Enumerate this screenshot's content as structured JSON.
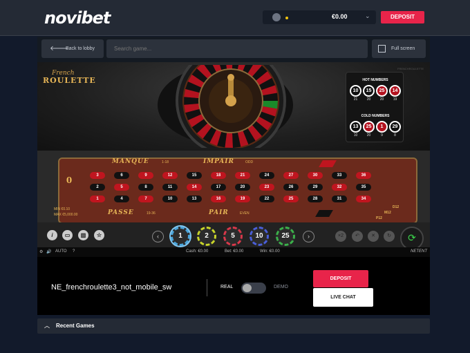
{
  "header": {
    "logo": "novibet",
    "balance": "€0.00",
    "deposit_label": "DEPOSIT"
  },
  "toolbar": {
    "back_label": "Back to lobby",
    "search_placeholder": "Search game...",
    "fullscreen_label": "Full screen"
  },
  "game": {
    "logo_line1": "French",
    "logo_line2": "ROULETTE",
    "watermark": "FRENCHROULETTE",
    "hot_title": "HOT NUMBERS",
    "cold_title": "COLD NUMBERS",
    "hot_numbers": [
      {
        "num": "10",
        "count": "21",
        "color": "black"
      },
      {
        "num": "15",
        "count": "20",
        "color": "black"
      },
      {
        "num": "25",
        "count": "20",
        "color": "red"
      },
      {
        "num": "14",
        "count": "19",
        "color": "red"
      }
    ],
    "cold_numbers": [
      {
        "num": "13",
        "count": "10",
        "color": "black"
      },
      {
        "num": "25",
        "count": "20",
        "color": "red"
      },
      {
        "num": "1",
        "count": "9",
        "color": "red"
      },
      {
        "num": "29",
        "count": "8",
        "color": "black"
      }
    ],
    "table": {
      "zero": "0",
      "manque": "MANQUE",
      "manque_sub": "1-18",
      "impair": "IMPAIR",
      "impair_sub": "ODD",
      "passe": "PASSE",
      "passe_sub": "19-36",
      "pair": "PAIR",
      "pair_sub": "EVEN",
      "min": "MIN €0.10",
      "max": "MAX €5,000.00",
      "d12": "D12",
      "m12": "M12",
      "p12": "P12",
      "rows": [
        [
          {
            "n": "3",
            "c": "red"
          },
          {
            "n": "6",
            "c": "black"
          },
          {
            "n": "9",
            "c": "red"
          },
          {
            "n": "12",
            "c": "red"
          },
          {
            "n": "15",
            "c": "black"
          },
          {
            "n": "18",
            "c": "red"
          },
          {
            "n": "21",
            "c": "red"
          },
          {
            "n": "24",
            "c": "black"
          },
          {
            "n": "27",
            "c": "red"
          },
          {
            "n": "30",
            "c": "red"
          },
          {
            "n": "33",
            "c": "black"
          },
          {
            "n": "36",
            "c": "red"
          }
        ],
        [
          {
            "n": "2",
            "c": "black"
          },
          {
            "n": "5",
            "c": "red"
          },
          {
            "n": "8",
            "c": "black"
          },
          {
            "n": "11",
            "c": "black"
          },
          {
            "n": "14",
            "c": "red"
          },
          {
            "n": "17",
            "c": "black"
          },
          {
            "n": "20",
            "c": "black"
          },
          {
            "n": "23",
            "c": "red"
          },
          {
            "n": "26",
            "c": "black"
          },
          {
            "n": "29",
            "c": "black"
          },
          {
            "n": "32",
            "c": "red"
          },
          {
            "n": "35",
            "c": "black"
          }
        ],
        [
          {
            "n": "1",
            "c": "red"
          },
          {
            "n": "4",
            "c": "black"
          },
          {
            "n": "7",
            "c": "red"
          },
          {
            "n": "10",
            "c": "black"
          },
          {
            "n": "13",
            "c": "black"
          },
          {
            "n": "16",
            "c": "red"
          },
          {
            "n": "19",
            "c": "red"
          },
          {
            "n": "22",
            "c": "black"
          },
          {
            "n": "25",
            "c": "red"
          },
          {
            "n": "28",
            "c": "black"
          },
          {
            "n": "31",
            "c": "black"
          },
          {
            "n": "34",
            "c": "red"
          }
        ]
      ]
    },
    "chips": [
      "1",
      "2",
      "5",
      "10",
      "25"
    ],
    "chip_colors": [
      "#2b2b2b",
      "#2b2b2b",
      "#2b2b2b",
      "#2b2b2b",
      "#2b2b2b"
    ],
    "chip_ring_colors": [
      "#4aa3d8",
      "#c8d42a",
      "#d8384a",
      "#4a5ed8",
      "#3bb04a"
    ],
    "auto_label": "AUTO",
    "help_label": "?",
    "cash": "Cash: €0.00",
    "bet": "Bet: €0.00",
    "win": "Win: €0.00",
    "provider": "NETENT"
  },
  "info": {
    "game_id": "NE_frenchroulette3_not_mobile_sw",
    "real_label": "REAL",
    "demo_label": "DEMO",
    "deposit_label": "DEPOSIT",
    "chat_label": "LIVE CHAT"
  },
  "recent": {
    "label": "Recent Games"
  }
}
